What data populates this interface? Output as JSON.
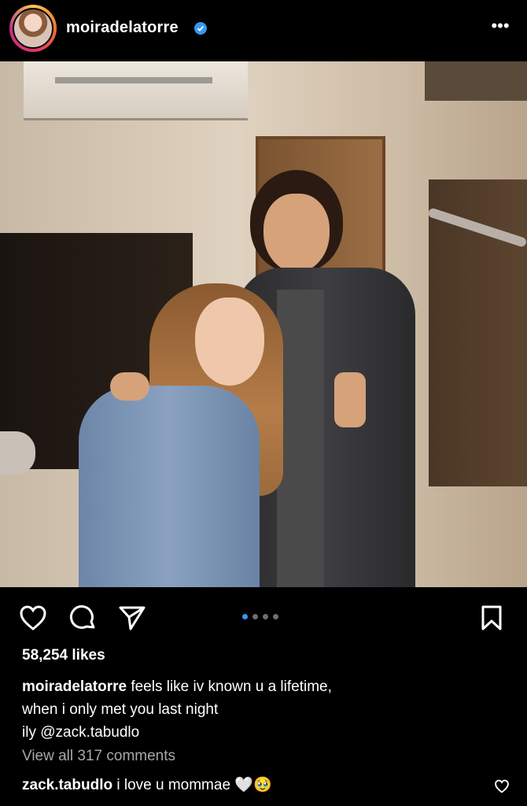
{
  "header": {
    "username": "moiradelatorre",
    "more_label": "•••",
    "icons": [
      "avatar",
      "verified-badge-icon",
      "more-options-icon"
    ]
  },
  "post": {
    "image_description_icon": "photo",
    "carousel": {
      "count": 4,
      "active_index": 0
    }
  },
  "actions": {
    "icons": [
      "heart-icon",
      "comment-icon",
      "share-icon",
      "bookmark-icon"
    ]
  },
  "likes": "58,254 likes",
  "caption": {
    "username": "moiradelatorre",
    "line1": "feels like iv known u a lifetime,",
    "line2": "when i only met you last night",
    "line3": "ily @zack.tabudlo"
  },
  "view_all_comments": "View all 317 comments",
  "comment": {
    "username": "zack.tabudlo",
    "text": "i love u mommae",
    "emoji": "🤍🥹"
  },
  "colors": {
    "background": "#000000",
    "verified": "#3897f0",
    "active_dot": "#3897f0",
    "muted_text": "#a8a8a8"
  }
}
